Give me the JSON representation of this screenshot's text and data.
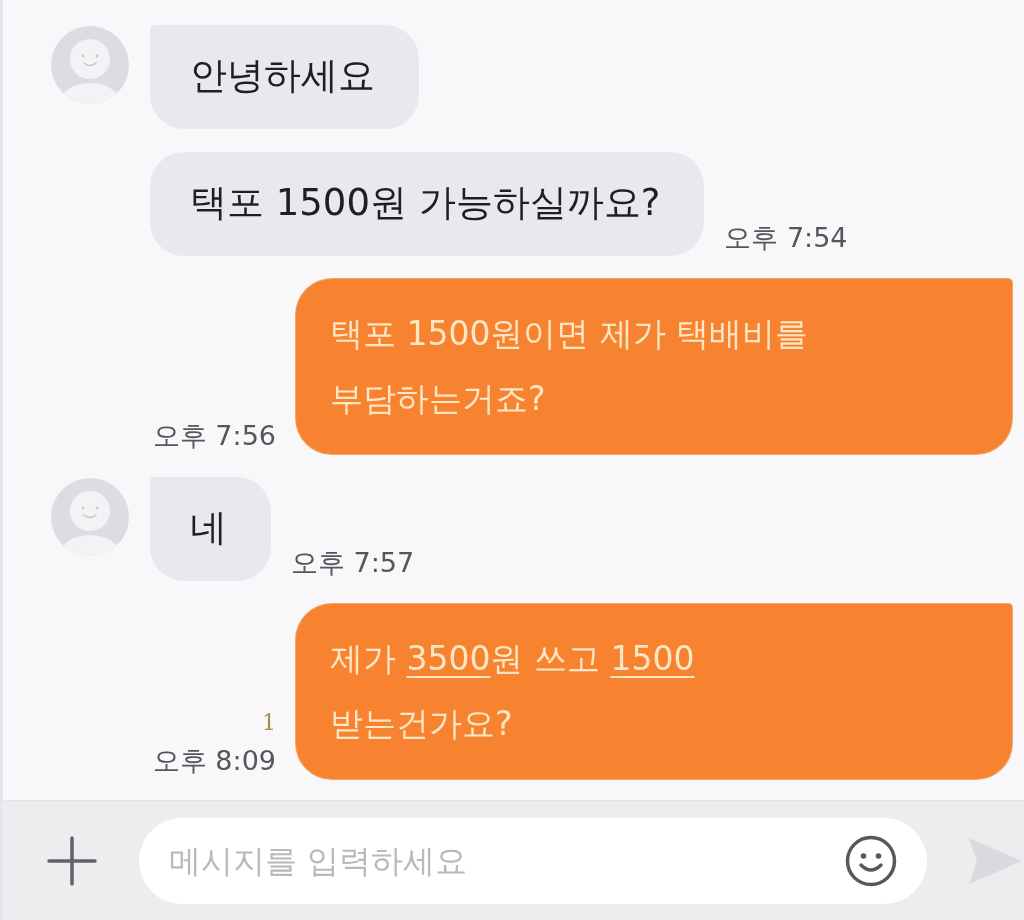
{
  "messages": [
    {
      "kind": "received",
      "show_avatar": true,
      "text": "안녕하세요"
    },
    {
      "kind": "received",
      "show_avatar": false,
      "text": "택포 1500원 가능하실까요?",
      "time": "오후 7:54"
    },
    {
      "kind": "sent",
      "text": "택포 1500원이면 제가 택배비를\n부담하는거죠?",
      "time": "오후 7:56"
    },
    {
      "kind": "received",
      "show_avatar": true,
      "text": "네",
      "time": "오후 7:57"
    },
    {
      "kind": "sent",
      "segments": [
        {
          "kind": "text",
          "text": "제가 "
        },
        {
          "kind": "link",
          "text": "3500"
        },
        {
          "kind": "text",
          "text": "원 쓰고 "
        },
        {
          "kind": "link",
          "text": "1500"
        },
        {
          "kind": "text",
          "text": "\n받는건가요?"
        }
      ],
      "unread": "1",
      "time": "오후 8:09"
    }
  ],
  "composer": {
    "placeholder": "메시지를 입력하세요"
  }
}
